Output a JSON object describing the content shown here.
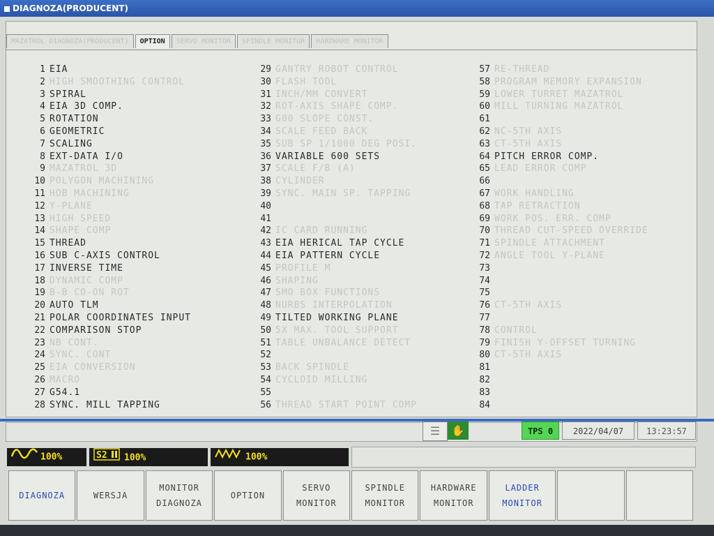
{
  "window": {
    "title": "DIAGNOZA(PRODUCENT)"
  },
  "tabs": [
    {
      "label": "MAZATROL DIAGNOZA(PRODUCENT)",
      "active": false
    },
    {
      "label": "OPTION",
      "active": true
    },
    {
      "label": "SERVO MONITOR",
      "active": false
    },
    {
      "label": "SPINDLE MONITOR",
      "active": false
    },
    {
      "label": "HARDWARE MONITOR",
      "active": false
    }
  ],
  "options": {
    "col1": [
      {
        "num": "1",
        "label": "EIA",
        "enabled": true
      },
      {
        "num": "2",
        "label": "HIGH SMOOTHING CONTROL",
        "enabled": false
      },
      {
        "num": "3",
        "label": "SPIRAL",
        "enabled": true
      },
      {
        "num": "4",
        "label": "EIA 3D COMP.",
        "enabled": true
      },
      {
        "num": "5",
        "label": "ROTATION",
        "enabled": true
      },
      {
        "num": "6",
        "label": "GEOMETRIC",
        "enabled": true
      },
      {
        "num": "7",
        "label": "SCALING",
        "enabled": true
      },
      {
        "num": "8",
        "label": "EXT-DATA I/O",
        "enabled": true
      },
      {
        "num": "9",
        "label": "MAZATROL 3D",
        "enabled": false
      },
      {
        "num": "10",
        "label": "POLYGON MACHINING",
        "enabled": false
      },
      {
        "num": "11",
        "label": "HOB MACHINING",
        "enabled": false
      },
      {
        "num": "12",
        "label": "Y-PLANE",
        "enabled": false
      },
      {
        "num": "13",
        "label": "HIGH SPEED",
        "enabled": false
      },
      {
        "num": "14",
        "label": "SHAPE COMP",
        "enabled": false
      },
      {
        "num": "15",
        "label": "THREAD",
        "enabled": true
      },
      {
        "num": "16",
        "label": "SUB C-AXIS CONTROL",
        "enabled": true
      },
      {
        "num": "17",
        "label": "INVERSE TIME",
        "enabled": true
      },
      {
        "num": "18",
        "label": "DYNAMIC COMP",
        "enabled": false
      },
      {
        "num": "19",
        "label": "B-B CO-ON ROT",
        "enabled": false
      },
      {
        "num": "20",
        "label": "AUTO TLM",
        "enabled": true
      },
      {
        "num": "21",
        "label": "POLAR COORDINATES INPUT",
        "enabled": true
      },
      {
        "num": "22",
        "label": "COMPARISON STOP",
        "enabled": true
      },
      {
        "num": "23",
        "label": "NB CONT.",
        "enabled": false
      },
      {
        "num": "24",
        "label": "SYNC. CONT",
        "enabled": false
      },
      {
        "num": "25",
        "label": "EIA CONVERSION",
        "enabled": false
      },
      {
        "num": "26",
        "label": "MACRO",
        "enabled": false
      },
      {
        "num": "27",
        "label": "G54.1",
        "enabled": true
      },
      {
        "num": "28",
        "label": "SYNC. MILL TAPPING",
        "enabled": true
      }
    ],
    "col2": [
      {
        "num": "29",
        "label": "GANTRY ROBOT CONTROL",
        "enabled": false
      },
      {
        "num": "30",
        "label": "FLASH TOOL",
        "enabled": false
      },
      {
        "num": "31",
        "label": "INCH/MM CONVERT",
        "enabled": false
      },
      {
        "num": "32",
        "label": "ROT-AXIS SHAPE COMP.",
        "enabled": false
      },
      {
        "num": "33",
        "label": "G00 SLOPE CONST.",
        "enabled": false
      },
      {
        "num": "34",
        "label": "SCALE FEED BACK",
        "enabled": false
      },
      {
        "num": "35",
        "label": "SUB SP 1/1000 DEG POSI.",
        "enabled": false
      },
      {
        "num": "36",
        "label": "VARIABLE 600 SETS",
        "enabled": true
      },
      {
        "num": "37",
        "label": "SCALE F/B (A)",
        "enabled": false
      },
      {
        "num": "38",
        "label": "CYLINDER",
        "enabled": false
      },
      {
        "num": "39",
        "label": "SYNC. MAIN SP. TAPPING",
        "enabled": false
      },
      {
        "num": "40",
        "label": "",
        "enabled": false
      },
      {
        "num": "41",
        "label": "",
        "enabled": false
      },
      {
        "num": "42",
        "label": "IC CARD RUNNING",
        "enabled": false
      },
      {
        "num": "43",
        "label": "EIA HERICAL TAP CYCLE",
        "enabled": true
      },
      {
        "num": "44",
        "label": "EIA PATTERN CYCLE",
        "enabled": true
      },
      {
        "num": "45",
        "label": "PROFILE M",
        "enabled": false
      },
      {
        "num": "46",
        "label": "SHAPING",
        "enabled": false
      },
      {
        "num": "47",
        "label": "SMO BOX FUNCTIONS",
        "enabled": false
      },
      {
        "num": "48",
        "label": "NURBS INTERPOLATION",
        "enabled": false
      },
      {
        "num": "49",
        "label": "TILTED WORKING PLANE",
        "enabled": true
      },
      {
        "num": "50",
        "label": "5X MAX. TOOL SUPPORT",
        "enabled": false
      },
      {
        "num": "51",
        "label": "TABLE UNBALANCE DETECT",
        "enabled": false
      },
      {
        "num": "52",
        "label": "",
        "enabled": false
      },
      {
        "num": "53",
        "label": "BACK SPINDLE",
        "enabled": false
      },
      {
        "num": "54",
        "label": "CYCLOID MILLING",
        "enabled": false
      },
      {
        "num": "55",
        "label": "",
        "enabled": false
      },
      {
        "num": "56",
        "label": "THREAD START POINT COMP",
        "enabled": false
      }
    ],
    "col3": [
      {
        "num": "57",
        "label": "RE-THREAD",
        "enabled": false
      },
      {
        "num": "58",
        "label": "PROGRAM MEMORY EXPANSION",
        "enabled": false
      },
      {
        "num": "59",
        "label": "LOWER TURRET MAZATROL",
        "enabled": false
      },
      {
        "num": "60",
        "label": "MILL TURNING MAZATROL",
        "enabled": false
      },
      {
        "num": "61",
        "label": "",
        "enabled": false
      },
      {
        "num": "62",
        "label": "NC-5TH AXIS",
        "enabled": false
      },
      {
        "num": "63",
        "label": "CT-5TH AXIS",
        "enabled": false
      },
      {
        "num": "64",
        "label": "PITCH ERROR COMP.",
        "enabled": true
      },
      {
        "num": "65",
        "label": "LEAD ERROR COMP",
        "enabled": false
      },
      {
        "num": "66",
        "label": "",
        "enabled": false
      },
      {
        "num": "67",
        "label": "WORK HANDLING",
        "enabled": false
      },
      {
        "num": "68",
        "label": "TAP RETRACTION",
        "enabled": false
      },
      {
        "num": "69",
        "label": "WORK POS. ERR. COMP",
        "enabled": false
      },
      {
        "num": "70",
        "label": "THREAD CUT-SPEED OVERRIDE",
        "enabled": false
      },
      {
        "num": "71",
        "label": "SPINDLE ATTACHMENT",
        "enabled": false
      },
      {
        "num": "72",
        "label": "ANGLE TOOL Y-PLANE",
        "enabled": false
      },
      {
        "num": "73",
        "label": "",
        "enabled": false
      },
      {
        "num": "74",
        "label": "",
        "enabled": false
      },
      {
        "num": "75",
        "label": "",
        "enabled": false
      },
      {
        "num": "76",
        "label": "CT-5TH AXIS",
        "enabled": false
      },
      {
        "num": "77",
        "label": "",
        "enabled": false
      },
      {
        "num": "78",
        "label": "CONTROL",
        "enabled": false
      },
      {
        "num": "79",
        "label": "FINISH Y-OFFSET TURNING",
        "enabled": false
      },
      {
        "num": "80",
        "label": "CT-5TH AXIS",
        "enabled": false
      },
      {
        "num": "81",
        "label": "",
        "enabled": false
      },
      {
        "num": "82",
        "label": "",
        "enabled": false
      },
      {
        "num": "83",
        "label": "",
        "enabled": false
      },
      {
        "num": "84",
        "label": "",
        "enabled": false
      }
    ]
  },
  "status": {
    "tps_label": "TPS 0",
    "date": "2022/04/07",
    "time": "13:23:57",
    "icon1": "program-doc-icon",
    "icon2": "manual-handle-icon"
  },
  "overrides": [
    {
      "icon": "rapid-wave-icon",
      "label": "100%",
      "value": 100
    },
    {
      "icon": "spindle-s2-icon",
      "label": "100%",
      "value": 100
    },
    {
      "icon": "feed-zigzag-icon",
      "label": "100%",
      "value": 100
    }
  ],
  "fkeys": [
    {
      "label1": "DIAGNOZA",
      "label2": "",
      "color": "#2a4ab8"
    },
    {
      "label1": "WERSJA",
      "label2": "",
      "color": "#444444"
    },
    {
      "label1": "MONITOR",
      "label2": "DIAGNOZA",
      "color": "#444444"
    },
    {
      "label1": "OPTION",
      "label2": "",
      "color": "#444444"
    },
    {
      "label1": "SERVO",
      "label2": "MONITOR",
      "color": "#444444"
    },
    {
      "label1": "SPINDLE",
      "label2": "MONITOR",
      "color": "#444444"
    },
    {
      "label1": "HARDWARE",
      "label2": "MONITOR",
      "color": "#444444"
    },
    {
      "label1": "LADDER",
      "label2": "MONITOR",
      "color": "#2a4ab8"
    },
    {
      "label1": "",
      "label2": "",
      "color": "#444444"
    },
    {
      "label1": "",
      "label2": "",
      "color": "#444444"
    }
  ]
}
